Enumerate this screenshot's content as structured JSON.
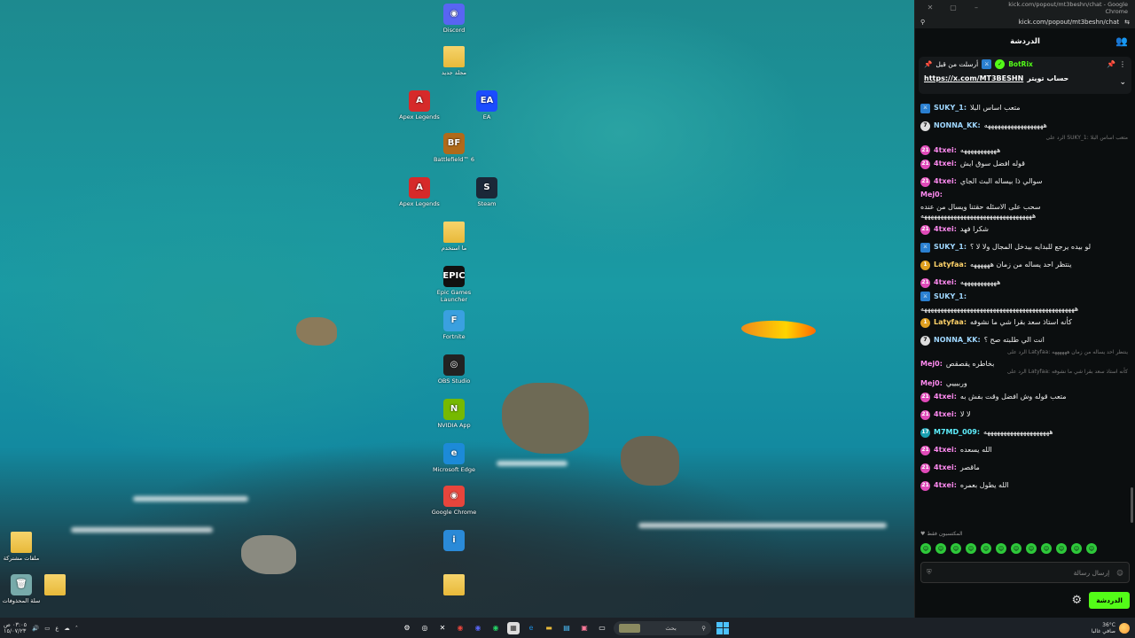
{
  "desktop": {
    "icons": [
      {
        "label": "Discord",
        "glyph": "discord-icon",
        "color": "#5865f2",
        "char": "◉"
      },
      {
        "label": "مجلد جديد",
        "glyph": "folder-icon",
        "color": "#e8b93a",
        "char": "",
        "folder": true
      },
      {
        "label": "Apex Legends",
        "glyph": "apex-icon",
        "color": "#d62a2a",
        "char": "A"
      },
      {
        "label": "EA",
        "glyph": "ea-icon",
        "color": "#1b4cff",
        "char": "EA"
      },
      {
        "label": "Battlefield™ 6",
        "glyph": "battlefield-icon",
        "color": "#b06a1a",
        "char": "BF"
      },
      {
        "label": "Apex Legends",
        "glyph": "apex-icon",
        "color": "#d62a2a",
        "char": "A"
      },
      {
        "label": "Steam",
        "glyph": "steam-icon",
        "color": "#1b2838",
        "char": "S"
      },
      {
        "label": "ما استخدم",
        "glyph": "folder-icon",
        "color": "#e8b93a",
        "char": "",
        "folder": true
      },
      {
        "label": "Epic Games Launcher",
        "glyph": "epic-icon",
        "color": "#111",
        "char": "EPIC"
      },
      {
        "label": "Fortnite",
        "glyph": "fortnite-icon",
        "color": "#3aa0e0",
        "char": "F"
      },
      {
        "label": "OBS Studio",
        "glyph": "obs-icon",
        "color": "#222",
        "char": "◎"
      },
      {
        "label": "NVIDIA App",
        "glyph": "nvidia-icon",
        "color": "#76b900",
        "char": "N"
      },
      {
        "label": "Microsoft Edge",
        "glyph": "edge-icon",
        "color": "#1c8ad8",
        "char": "e"
      },
      {
        "label": "Google Chrome",
        "glyph": "chrome-icon",
        "color": "#e8453c",
        "char": "◉"
      },
      {
        "label": "",
        "glyph": "app-icon",
        "color": "#2a8ad8",
        "char": "i"
      },
      {
        "label": "",
        "glyph": "folder-icon",
        "color": "#e8b93a",
        "char": "",
        "folder": true
      },
      {
        "label": "ملفات مشتركة",
        "glyph": "folder-icon",
        "color": "#e8b93a",
        "char": "",
        "folder": true
      },
      {
        "label": "سلة المحذوفات",
        "glyph": "recycle-bin-icon",
        "color": "#7aa",
        "char": "🗑"
      },
      {
        "label": "",
        "glyph": "folder-icon",
        "color": "#e8b93a",
        "char": "",
        "folder": true
      }
    ]
  },
  "window": {
    "title": "kick.com/popout/mt3beshn/chat - Google Chrome",
    "url": "kick.com/popout/mt3beshn/chat"
  },
  "chat": {
    "header": "الدردشة",
    "pinned": {
      "by_label": "أرسلت من قبل",
      "bot": "BotRix",
      "link": "https://x.com/MT3BESHN",
      "link_desc": "حساب تويتر"
    },
    "messages": [
      {
        "reply": "",
        "user": "",
        "text": "متعب اساس البلا",
        "badge": "",
        "color": "#fff",
        "partial": true
      },
      {
        "reply": "",
        "user": "SUKY_1:",
        "text": "متعب اساس البلا",
        "badge": "sq",
        "color": "#9fd7ff",
        "bc": "#2a7fd0"
      },
      {
        "reply": "",
        "user": "NONNA_KK:",
        "text": "ههههههههههههههههههه",
        "badge": "7",
        "color": "#9fd7ff",
        "bc": "#ddd"
      },
      {
        "reply": "الرد على SUKY_1: متعب اساس البلا",
        "user": "4txei:",
        "text": "هههههههههههه",
        "badge": "21",
        "color": "#ff8af0",
        "bc": "#e04ab8"
      },
      {
        "reply": "",
        "user": "4txei:",
        "text": "قوله افضل سوق ايش",
        "badge": "21",
        "color": "#ff8af0",
        "bc": "#e04ab8"
      },
      {
        "reply": "",
        "user": "4txei:",
        "text": "سوالي ذا بيساله البث الجاي",
        "badge": "21",
        "color": "#ff8af0",
        "bc": "#e04ab8"
      },
      {
        "reply": "",
        "user": "Mej0:",
        "text": "سحب على الاسئله حقتنا ويسال من عنده ههههههههههههههههههههههههههههههههههه",
        "badge": "",
        "color": "#ff8af0",
        "bc": ""
      },
      {
        "reply": "",
        "user": "4txei:",
        "text": "شكرا فهد",
        "badge": "21",
        "color": "#ff8af0",
        "bc": "#e04ab8"
      },
      {
        "reply": "",
        "user": "SUKY_1:",
        "text": "لو بيده يرجع للبدايه بيدخل المجال ولا لا ؟",
        "badge": "sq",
        "color": "#9fd7ff",
        "bc": "#2a7fd0"
      },
      {
        "reply": "",
        "user": "Latyfaa:",
        "text": "ينتظر احد يساله من زمان ههههههه",
        "badge": "1",
        "color": "#ffd36a",
        "bc": "#e0a020"
      },
      {
        "reply": "",
        "user": "4txei:",
        "text": "هههههههههههه",
        "badge": "21",
        "color": "#ff8af0",
        "bc": "#e04ab8"
      },
      {
        "reply": "",
        "user": "SUKY_1:",
        "text": "هههههههههههههههههههههههههههههههههههههههههههههههه",
        "badge": "sq",
        "color": "#9fd7ff",
        "bc": "#2a7fd0"
      },
      {
        "reply": "",
        "user": "Latyfaa:",
        "text": "كأنه استاذ سعد بقرا شي ما نشوفه",
        "badge": "1",
        "color": "#ffd36a",
        "bc": "#e0a020"
      },
      {
        "reply": "",
        "user": "NONNA_KK:",
        "text": "انت الي طلبته صح ؟",
        "badge": "7",
        "color": "#9fd7ff",
        "bc": "#ddd"
      },
      {
        "reply": "الرد على Latyfaa: ينتظر احد يساله من زمان ههههههه",
        "user": "Mej0:",
        "text": "بخاطره يقصقص",
        "badge": "",
        "color": "#ff8af0",
        "bc": ""
      },
      {
        "reply": "الرد على Latyfaa: كأنه استاذ سعد بقرا شي ما نشوفه",
        "user": "Mej0:",
        "text": "وربيييي",
        "badge": "",
        "color": "#ff8af0",
        "bc": ""
      },
      {
        "reply": "",
        "user": "4txei:",
        "text": "متعب قوله وش افضل وقت بفش به",
        "badge": "21",
        "color": "#ff8af0",
        "bc": "#e04ab8"
      },
      {
        "reply": "",
        "user": "4txei:",
        "text": "لا لا",
        "badge": "21",
        "color": "#ff8af0",
        "bc": "#e04ab8"
      },
      {
        "reply": "",
        "user": "M7MD_009:",
        "text": "ههههههههههههههههههههه",
        "badge": "17",
        "color": "#5ef0ff",
        "bc": "#1aa0b0"
      },
      {
        "reply": "",
        "user": "4txei:",
        "text": "الله يسعده",
        "badge": "21",
        "color": "#ff8af0",
        "bc": "#e04ab8"
      },
      {
        "reply": "",
        "user": "4txei:",
        "text": "ماقصر",
        "badge": "21",
        "color": "#ff8af0",
        "bc": "#e04ab8"
      },
      {
        "reply": "",
        "user": "4txei:",
        "text": "الله يطول بعمره",
        "badge": "21",
        "color": "#ff8af0",
        "bc": "#e04ab8"
      }
    ],
    "emotes_label": "المكتسبون فقط",
    "emote_count": 12,
    "input_placeholder": "إرسال رسالة",
    "send_label": "الدردشة"
  },
  "taskbar": {
    "clock_time": "٠٣:٠٥ ص",
    "clock_date": "١٥/٠٧/٢٣",
    "lang": "ع",
    "search_placeholder": "بحث",
    "weather_temp": "36°C",
    "weather_desc": "صافي غالبا"
  },
  "colors": {
    "accent": "#53fc18",
    "panel": "#0b0e0f"
  }
}
